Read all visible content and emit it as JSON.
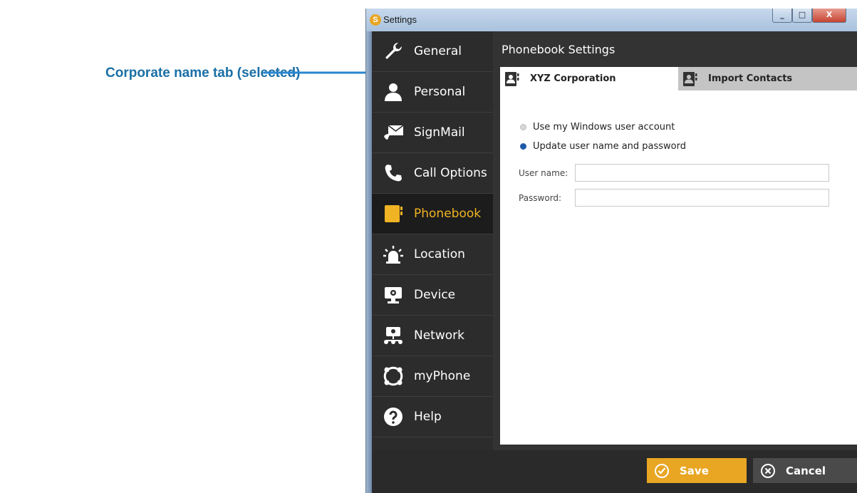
{
  "annotation": {
    "text": "Corporate name tab (selected)"
  },
  "window": {
    "title": "Settings",
    "app_logo": "S",
    "controls": {
      "minimize": "_",
      "maximize": "□",
      "close": "X"
    }
  },
  "sidebar": {
    "items": [
      {
        "label": "General",
        "icon": "wrench-icon"
      },
      {
        "label": "Personal",
        "icon": "person-icon"
      },
      {
        "label": "SignMail",
        "icon": "signmail-icon"
      },
      {
        "label": "Call Options",
        "icon": "phone-wrench-icon"
      },
      {
        "label": "Phonebook",
        "icon": "phonebook-icon",
        "active": true
      },
      {
        "label": "Location",
        "icon": "siren-icon"
      },
      {
        "label": "Device",
        "icon": "device-icon"
      },
      {
        "label": "Network",
        "icon": "network-icon"
      },
      {
        "label": "myPhone",
        "icon": "myphone-icon"
      },
      {
        "label": "Help",
        "icon": "help-icon"
      }
    ]
  },
  "panel": {
    "title": "Phonebook Settings",
    "tabs": [
      {
        "label": "XYZ Corporation",
        "active": true
      },
      {
        "label": "Import Contacts",
        "active": false
      }
    ],
    "options": [
      {
        "label": "Use my Windows user account",
        "selected": false
      },
      {
        "label": "Update user name and password",
        "selected": true
      }
    ],
    "fields": {
      "username_label": "User name:",
      "username_value": "",
      "password_label": "Password:",
      "password_value": ""
    }
  },
  "footer": {
    "save_label": "Save",
    "cancel_label": "Cancel"
  },
  "colors": {
    "accent": "#f0b323",
    "save": "#e8a623",
    "annotation": "#1a6fa6",
    "radio_selected": "#1f5aa8"
  }
}
